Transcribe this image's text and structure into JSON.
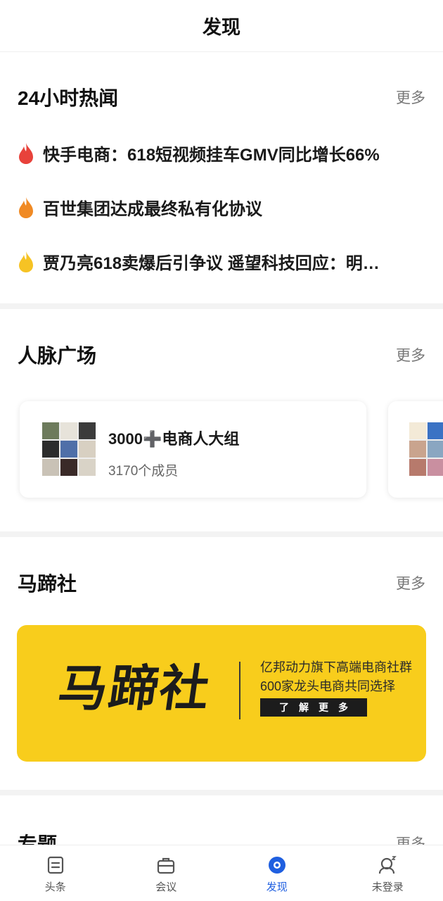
{
  "header": {
    "title": "发现"
  },
  "hot_news": {
    "title": "24小时热闻",
    "more": "更多",
    "items": [
      {
        "text": "快手电商：618短视频挂车GMV同比增长66%",
        "flame_color": "#e8423b"
      },
      {
        "text": "百世集团达成最终私有化协议",
        "flame_color": "#f08a24"
      },
      {
        "text": "贾乃亮618卖爆后引争议 遥望科技回应：明…",
        "flame_color": "#f6c324"
      }
    ]
  },
  "network": {
    "title": "人脉广场",
    "more": "更多",
    "groups": [
      {
        "name": "3000➕电商人大组",
        "members": "3170个成员"
      }
    ]
  },
  "mati": {
    "title": "马蹄社",
    "more": "更多",
    "banner": {
      "logo_text": "马蹄社",
      "line1": "亿邦动力旗下高端电商社群",
      "line2": "600家龙头电商共同选择",
      "button": "了解更多",
      "bg_color": "#f8cd1c"
    }
  },
  "topics": {
    "title": "专题",
    "more": "更多"
  },
  "tabbar": {
    "items": [
      {
        "label": "头条",
        "icon": "document-icon"
      },
      {
        "label": "会议",
        "icon": "briefcase-icon"
      },
      {
        "label": "发现",
        "icon": "discover-icon",
        "active": true
      },
      {
        "label": "未登录",
        "icon": "user-sleep-icon"
      }
    ],
    "active_color": "#1f5fe0"
  }
}
